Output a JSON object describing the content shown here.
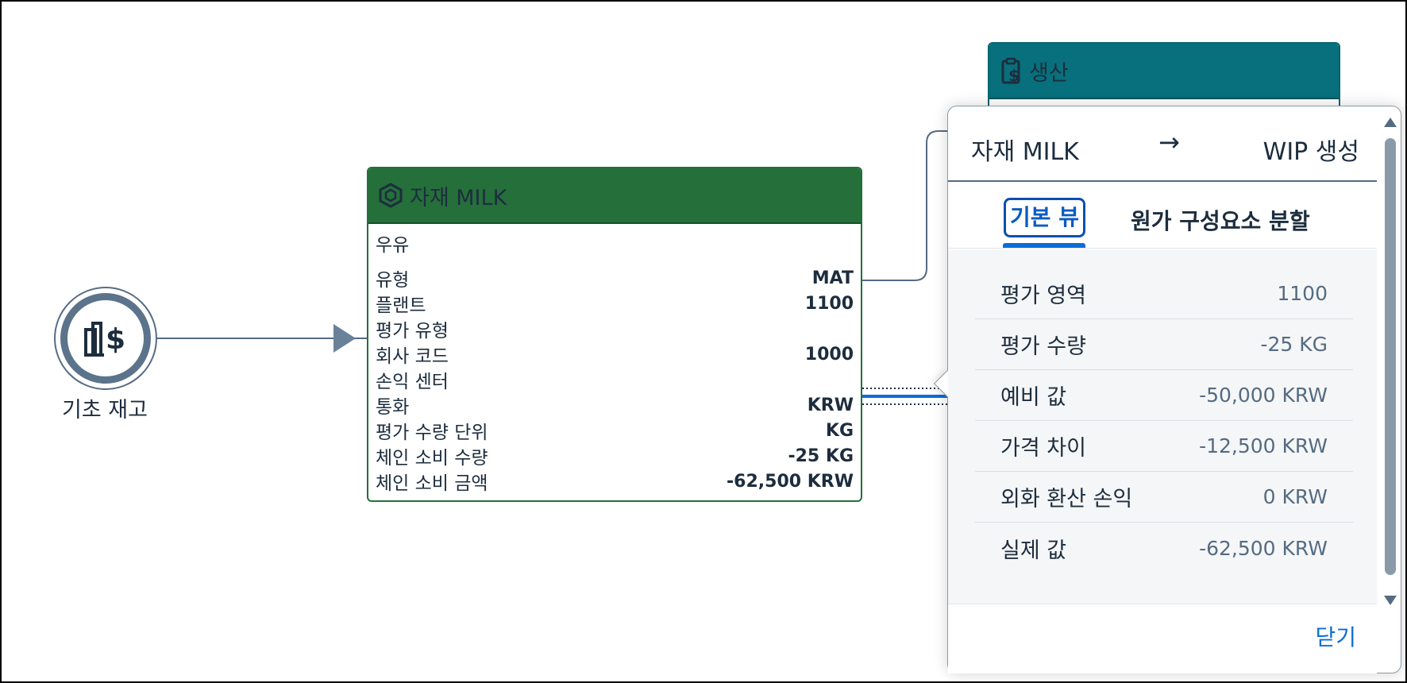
{
  "start_node": {
    "label": "기초 재고",
    "icon": "building-dollar-icon"
  },
  "material_card": {
    "title": "자재 MILK",
    "icon": "material-cube-icon",
    "header_color": "#256f3a",
    "subtitle": "우유",
    "attributes": [
      {
        "label": "유형",
        "value": "MAT"
      },
      {
        "label": "플랜트",
        "value": "1100"
      },
      {
        "label": "평가 유형",
        "value": ""
      },
      {
        "label": "회사 코드",
        "value": "1000"
      },
      {
        "label": "손익 센터",
        "value": ""
      },
      {
        "label": "통화",
        "value": "KRW"
      },
      {
        "label": "평가 수량 단위",
        "value": "KG"
      },
      {
        "label": "체인 소비 수량",
        "value": "-25 KG"
      },
      {
        "label": "체인 소비 금액",
        "value": "-62,500 KRW"
      }
    ]
  },
  "production_card": {
    "title": "생산",
    "icon": "clipboard-dollar-icon",
    "header_color": "#07707c"
  },
  "popover": {
    "from": "자재 MILK",
    "arrow": "→",
    "to": "WIP 생성",
    "tabs": {
      "basic": "기본 뷰",
      "cost": "원가 구성요소 분할"
    },
    "rows": [
      {
        "label": "평가 영역",
        "value": "1100"
      },
      {
        "label": "평가 수량",
        "value": "-25 KG"
      },
      {
        "label": "예비 값",
        "value": "-50,000 KRW"
      },
      {
        "label": "가격 차이",
        "value": "-12,500 KRW"
      },
      {
        "label": "외화 환산 손익",
        "value": "0 KRW"
      },
      {
        "label": "실제 값",
        "value": "-62,500 KRW"
      }
    ],
    "close_label": "닫기",
    "accent_color": "#0b6ed6"
  }
}
